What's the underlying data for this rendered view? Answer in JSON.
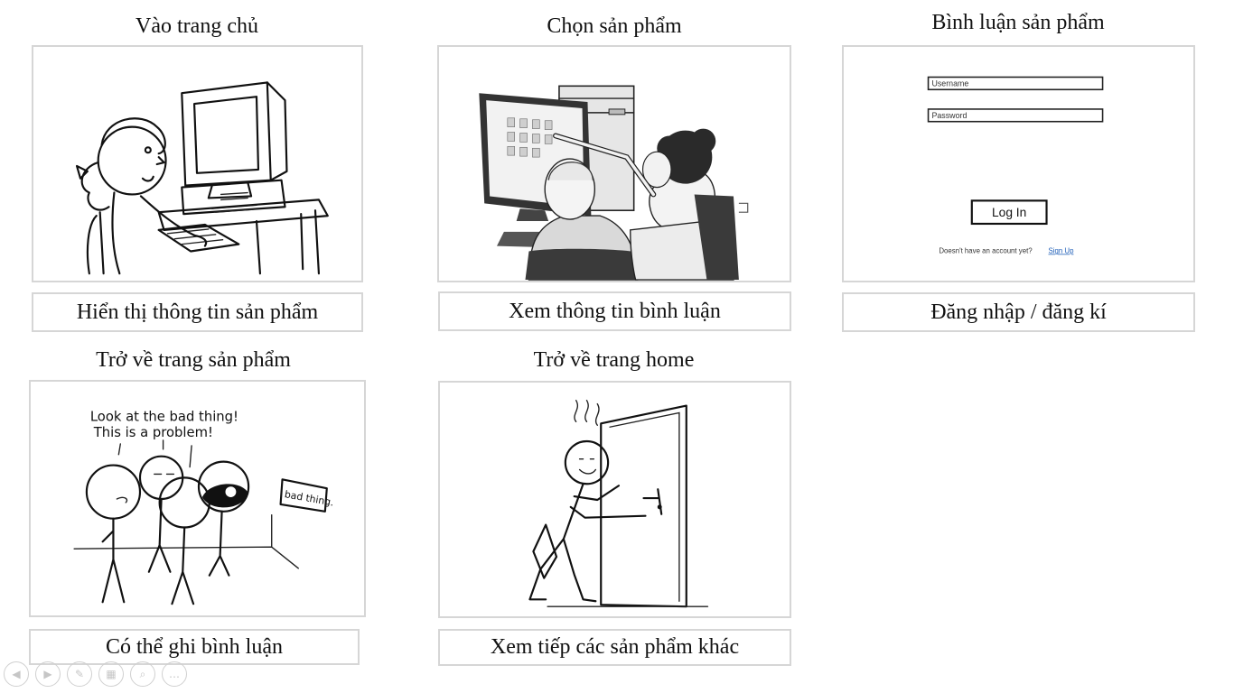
{
  "panels": {
    "p1": {
      "title": "Vào trang chủ",
      "caption": "Hiển thị thông tin sản phẩm"
    },
    "p2": {
      "title": "Chọn sản phẩm",
      "caption": "Xem thông tin bình luận"
    },
    "p3": {
      "title": "Bình luận sản phẩm",
      "caption": "Đăng nhập / đăng kí"
    },
    "p4": {
      "title": "Trở về trang sản phẩm",
      "caption": "Có thể ghi bình luận"
    },
    "p5": {
      "title": "Trở về trang home",
      "caption": "Xem tiếp các sản phẩm khác"
    }
  },
  "login": {
    "username_placeholder": "Username",
    "password_placeholder": "Password",
    "button": "Log In",
    "signup_prompt": "Doesn't have an account yet?",
    "signup_link": "Sign Up"
  },
  "comic": {
    "speech_line1": "Look at the bad thing!",
    "speech_line2": "This is a problem!",
    "sign": "bad thing."
  },
  "controls": [
    {
      "icon": "previous-icon",
      "glyph": "◀"
    },
    {
      "icon": "next-icon",
      "glyph": "▶"
    },
    {
      "icon": "pen-icon",
      "glyph": "✎"
    },
    {
      "icon": "slides-icon",
      "glyph": "▦"
    },
    {
      "icon": "zoom-icon",
      "glyph": "⌕"
    },
    {
      "icon": "more-icon",
      "glyph": "…"
    }
  ]
}
